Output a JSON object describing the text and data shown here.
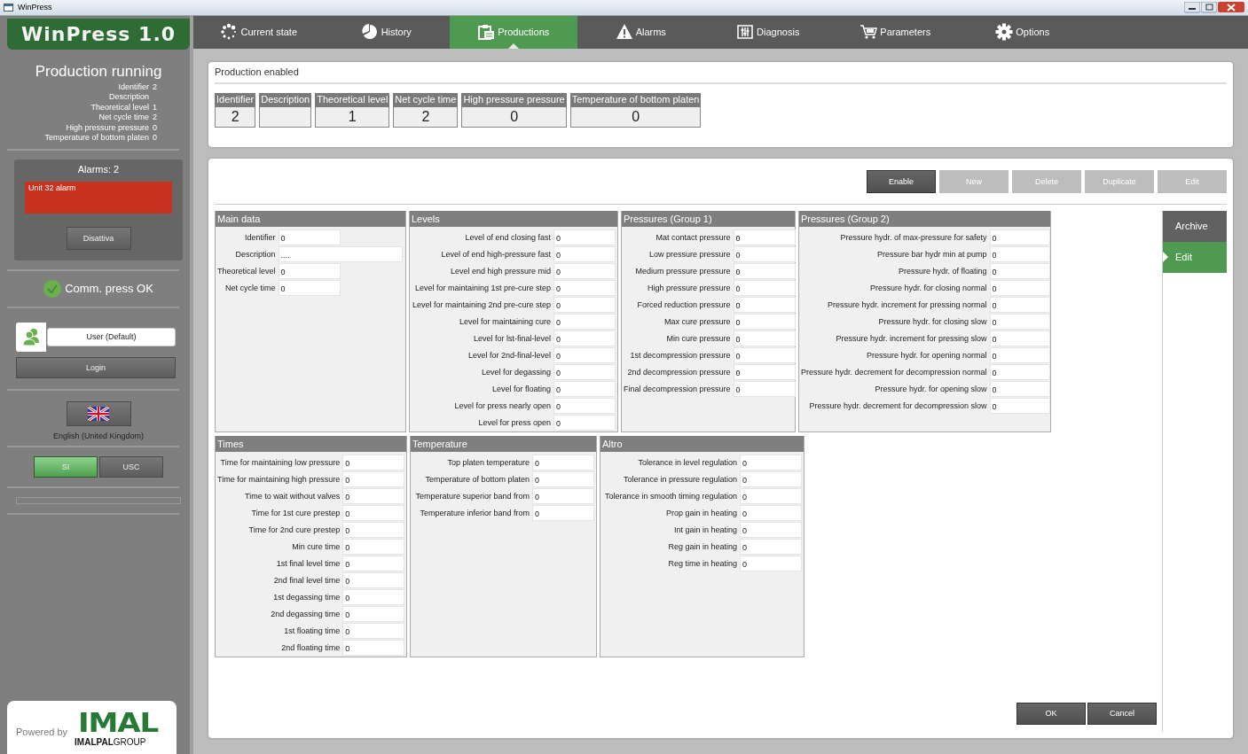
{
  "window": {
    "title": "WinPress"
  },
  "app_title": "WinPress 1.0",
  "sidebar": {
    "status_title": "Production running",
    "summary": [
      {
        "label": "Identifier",
        "value": "2"
      },
      {
        "label": "Description"
      },
      {
        "label": "Theoretical level",
        "value": "1"
      },
      {
        "label": "Net cycle time",
        "value": "2"
      },
      {
        "label": "High pressure pressure",
        "value": "0"
      },
      {
        "label": "Temperature of bottom platen",
        "value": "0"
      }
    ],
    "alarms": {
      "title": "Alarms: 2",
      "items": [
        "Unit 32 alarm"
      ],
      "button": "Disattiva"
    },
    "comm": "Comm. press OK",
    "user": {
      "value": "User (Default)"
    },
    "login": "Login",
    "language": "English (United Kingdom)",
    "units": [
      {
        "label": "SI",
        "selected": true
      },
      {
        "label": "USC",
        "selected": false
      }
    ],
    "progress": {
      "level": 0
    },
    "powered_by": "Powered by",
    "logo": {
      "name": "IMAL",
      "group_bold": "IMALPAL",
      "group_light": "GROUP"
    }
  },
  "tabs": [
    {
      "label": "Current state",
      "selected": false
    },
    {
      "label": "History",
      "selected": false
    },
    {
      "label": "Productions",
      "selected": true
    },
    {
      "label": "Alarms",
      "selected": false
    },
    {
      "label": "Diagnosis",
      "selected": false
    },
    {
      "label": "Parameters",
      "selected": false
    },
    {
      "label": "Options",
      "selected": false
    }
  ],
  "production_status": "Production enabled",
  "summary_columns": [
    {
      "label": "Identifier",
      "value": "2"
    },
    {
      "label": "Description"
    },
    {
      "label": "Theoretical level",
      "value": "1"
    },
    {
      "label": "Net cycle time",
      "value": "2"
    },
    {
      "label": "High pressure pressure",
      "value": "0"
    },
    {
      "label": "Temperature of bottom platen",
      "value": "0"
    }
  ],
  "toolbar": [
    {
      "label": "Enable",
      "disabled": false
    },
    {
      "label": "New",
      "disabled": true
    },
    {
      "label": "Delete",
      "disabled": true
    },
    {
      "label": "Duplicate",
      "disabled": true
    },
    {
      "label": "Edit",
      "disabled": true
    }
  ],
  "sections": [
    {
      "title": "Main data",
      "fields": [
        {
          "label": "Identifier",
          "value": "0"
        },
        {
          "label": "Description",
          "value": "...."
        },
        {
          "label": "Theoretical level",
          "value": "0"
        },
        {
          "label": "Net cycle time",
          "value": "0"
        }
      ]
    },
    {
      "title": "Levels",
      "fields": [
        {
          "label": "Level of end closing fast",
          "value": "0"
        },
        {
          "label": "Level of end high-pressure fast",
          "value": "0"
        },
        {
          "label": "Level end high pressure mid",
          "value": "0"
        },
        {
          "label": "Level for maintaining 1st pre-cure step",
          "value": "0"
        },
        {
          "label": "Level for maintaining 2nd pre-cure step",
          "value": "0"
        },
        {
          "label": "Level for maintaining cure",
          "value": "0"
        },
        {
          "label": "Level for lst-final-level",
          "value": "0"
        },
        {
          "label": "Level for 2nd-final-level",
          "value": "0"
        },
        {
          "label": "Level for degassing",
          "value": "0"
        },
        {
          "label": "Level for floating",
          "value": "0"
        },
        {
          "label": "Level for press nearly open",
          "value": "0"
        },
        {
          "label": "Level for press open",
          "value": "0"
        }
      ]
    },
    {
      "title": "Pressures (Group 1)",
      "fields": [
        {
          "label": "Mat contact pressure",
          "value": "0"
        },
        {
          "label": "Low pressure pressure",
          "value": "0"
        },
        {
          "label": "Medium pressure pressure",
          "value": "0"
        },
        {
          "label": "High pressure pressure",
          "value": "0"
        },
        {
          "label": "Forced reduction pressure",
          "value": "0"
        },
        {
          "label": "Max cure pressure",
          "value": "0"
        },
        {
          "label": "Min cure pressure",
          "value": "0"
        },
        {
          "label": "1st decompression pressure",
          "value": "0"
        },
        {
          "label": "2nd decompression pressure",
          "value": "0"
        },
        {
          "label": "Final decompression pressure",
          "value": "0"
        }
      ]
    },
    {
      "title": "Pressures (Group 2)",
      "fields": [
        {
          "label": "Pressure hydr. of max-pressure for safety",
          "value": "0"
        },
        {
          "label": "Pressure bar hydr min at pump",
          "value": "0"
        },
        {
          "label": "Pressure hydr. of floating",
          "value": "0"
        },
        {
          "label": "Pressure hydr. for closing normal",
          "value": "0"
        },
        {
          "label": "Pressure hydr. increment for pressing normal",
          "value": "0"
        },
        {
          "label": "Pressure hydr. for closing slow",
          "value": "0"
        },
        {
          "label": "Pressure hydr. increment for pressing slow",
          "value": "0"
        },
        {
          "label": "Pressure hydr. for opening normal",
          "value": "0"
        },
        {
          "label": "Pressure hydr. decrement for decompression normal",
          "value": "0"
        },
        {
          "label": "Pressure hydr. for opening slow",
          "value": "0"
        },
        {
          "label": "Pressure hydr. decrement for decompression slow",
          "value": "0"
        }
      ]
    },
    {
      "title": "Times",
      "fields": [
        {
          "label": "Time for maintaining low pressure",
          "value": "0"
        },
        {
          "label": "Time for maintaining high pressure",
          "value": "0"
        },
        {
          "label": "Time to wait without valves",
          "value": "0"
        },
        {
          "label": "Time for 1st cure prestep",
          "value": "0"
        },
        {
          "label": "Time for 2nd cure prestep",
          "value": "0"
        },
        {
          "label": "Min cure time",
          "value": "0"
        },
        {
          "label": "1st final level time",
          "value": "0"
        },
        {
          "label": "2nd final level time",
          "value": "0"
        },
        {
          "label": "1st degassing time",
          "value": "0"
        },
        {
          "label": "2nd degassing time",
          "value": "0"
        },
        {
          "label": "1st floating time",
          "value": "0"
        },
        {
          "label": "2nd floating time",
          "value": "0"
        }
      ]
    },
    {
      "title": "Temperature",
      "fields": [
        {
          "label": "Top platen temperature",
          "value": "0"
        },
        {
          "label": "Temperature of bottom platen",
          "value": "0"
        },
        {
          "label": "Temperature superior band from",
          "value": "0"
        },
        {
          "label": "Temperature inferior band from",
          "value": "0"
        }
      ]
    },
    {
      "title": "Altro",
      "fields": [
        {
          "label": "Tolerance in level regulation",
          "value": "0"
        },
        {
          "label": "Tolerance in pressure regulation",
          "value": "0"
        },
        {
          "label": "Tolerance in smooth timing regulation",
          "value": "0"
        },
        {
          "label": "Prop gain in heating",
          "value": "0"
        },
        {
          "label": "Int gain in heating",
          "value": "0"
        },
        {
          "label": "Reg gain in heating",
          "value": "0"
        },
        {
          "label": "Reg time in heating",
          "value": "0"
        }
      ]
    }
  ],
  "side_tabs": [
    {
      "label": "Archive",
      "selected": false
    },
    {
      "label": "Edit",
      "selected": true
    }
  ],
  "dialog_buttons": [
    "OK",
    "Cancel"
  ]
}
